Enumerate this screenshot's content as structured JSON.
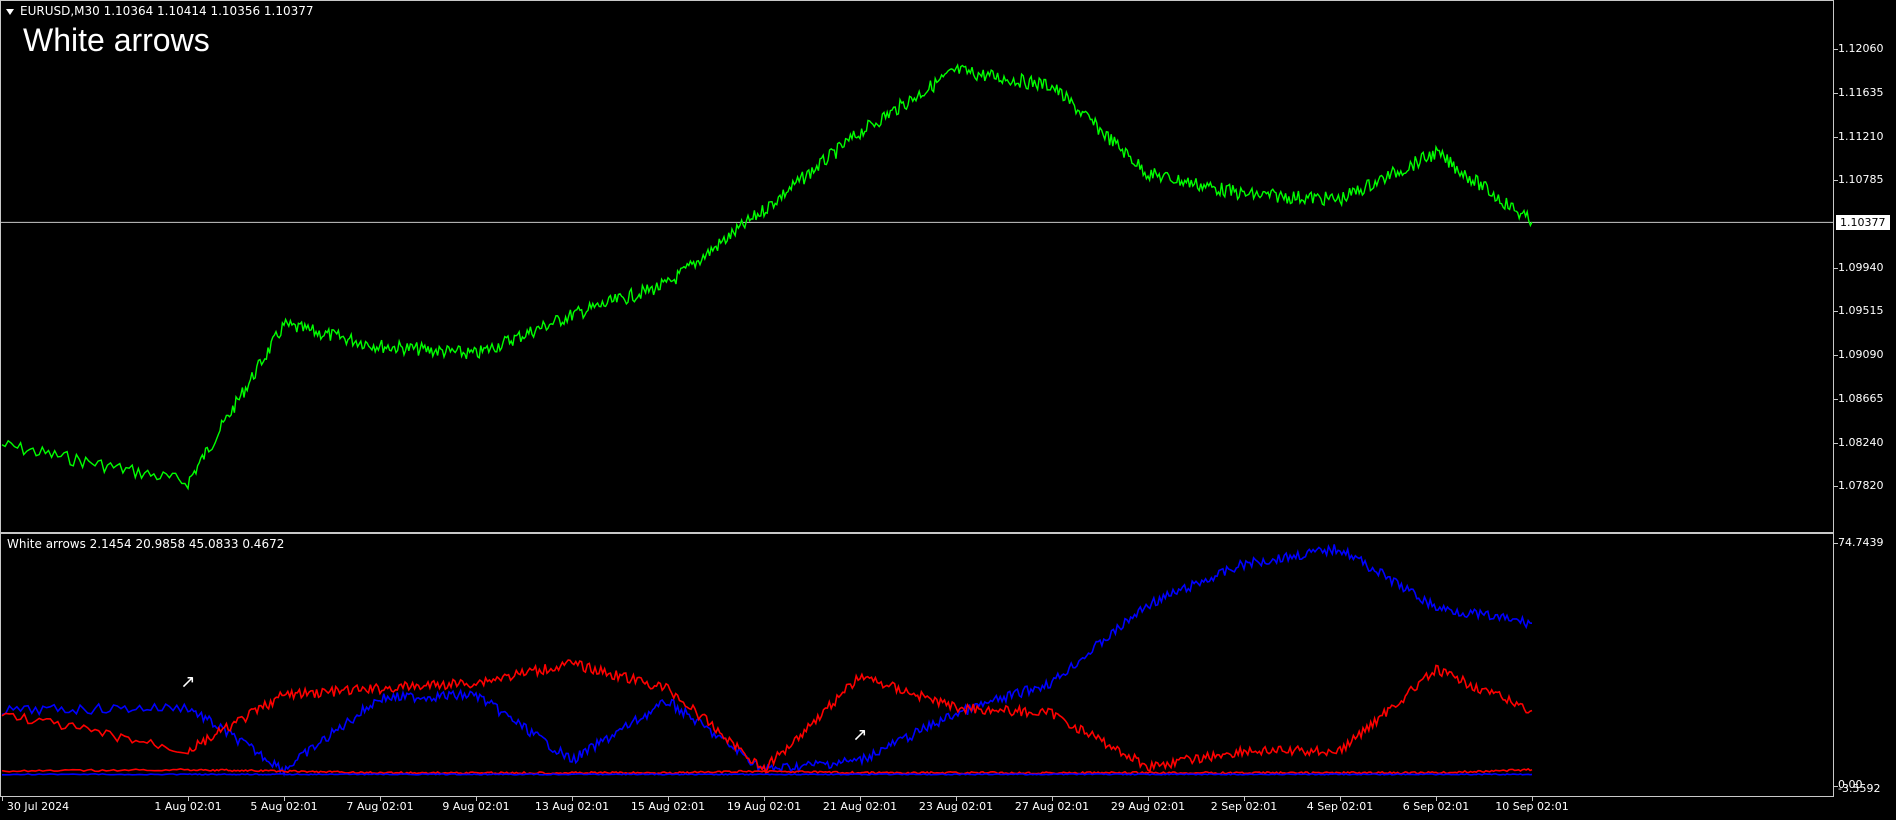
{
  "main_chart": {
    "symbol_menu_icon": "triangle-down-icon",
    "header": "EURUSD,M30  1.10364 1.10414 1.10356 1.10377",
    "indicator_overlay_title": "White arrows",
    "current_price": "1.10377",
    "price_line_color": "#c8c8c8",
    "series_color": "#00ff00",
    "y_ticks": [
      "1.12060",
      "1.11635",
      "1.11210",
      "1.10785",
      "1.09940",
      "1.09515",
      "1.09090",
      "1.08665",
      "1.08240",
      "1.07820"
    ]
  },
  "sub_window": {
    "header": "White arrows 2.1454 20.9858 45.0833 0.4672",
    "y_max_label": "74.7439",
    "y_zero_label": "0.00",
    "y_min_label": "-3.5592",
    "colors": {
      "blue": "#0000ff",
      "red": "#ff0000",
      "arrows": "#ffffff"
    }
  },
  "x_axis": {
    "labels": [
      "30 Jul 2024",
      "1 Aug 02:01",
      "5 Aug 02:01",
      "7 Aug 02:01",
      "9 Aug 02:01",
      "13 Aug 02:01",
      "15 Aug 02:01",
      "19 Aug 02:01",
      "21 Aug 02:01",
      "23 Aug 02:01",
      "27 Aug 02:01",
      "29 Aug 02:01",
      "2 Sep 02:01",
      "4 Sep 02:01",
      "6 Sep 02:01",
      "10 Sep 02:01"
    ]
  },
  "chart_data": [
    {
      "type": "line",
      "title": "",
      "symbol": "EURUSD",
      "timeframe": "M30",
      "ohlc_last": {
        "open": 1.10364,
        "high": 1.10414,
        "low": 1.10356,
        "close": 1.10377
      },
      "ylim": [
        1.0757,
        1.1232
      ],
      "x": [
        "30 Jul 2024",
        "1 Aug 02:01",
        "5 Aug 02:01",
        "7 Aug 02:01",
        "9 Aug 02:01",
        "13 Aug 02:01",
        "15 Aug 02:01",
        "19 Aug 02:01",
        "21 Aug 02:01",
        "23 Aug 02:01",
        "27 Aug 02:01",
        "29 Aug 02:01",
        "2 Sep 02:01",
        "4 Sep 02:01",
        "6 Sep 02:01",
        "10 Sep 02:01"
      ],
      "series": [
        {
          "values": [
            1.0822,
            1.0786,
            1.0938,
            1.0918,
            1.091,
            1.0948,
            1.0978,
            1.105,
            1.1125,
            1.1185,
            1.117,
            1.1085,
            1.1065,
            1.106,
            1.1105,
            1.1038
          ]
        }
      ]
    },
    {
      "type": "line",
      "title": "White arrows",
      "ylim": [
        -3.5592,
        74.7439
      ],
      "x": [
        "30 Jul 2024",
        "1 Aug 02:01",
        "5 Aug 02:01",
        "7 Aug 02:01",
        "9 Aug 02:01",
        "13 Aug 02:01",
        "15 Aug 02:01",
        "19 Aug 02:01",
        "21 Aug 02:01",
        "23 Aug 02:01",
        "27 Aug 02:01",
        "29 Aug 02:01",
        "2 Sep 02:01",
        "4 Sep 02:01",
        "6 Sep 02:01",
        "10 Sep 02:01"
      ],
      "series": [
        {
          "values": [
            21,
            22,
            2,
            25,
            26,
            5,
            24,
            2,
            5,
            20,
            30,
            55,
            68,
            73,
            54,
            49
          ]
        },
        {
          "values": [
            20,
            8,
            26,
            28,
            30,
            36,
            28,
            2,
            32,
            22,
            20,
            3,
            8,
            8,
            34,
            21
          ]
        },
        {
          "values": [
            1.5,
            2,
            1.5,
            1,
            1,
            1,
            1,
            1.5,
            1,
            1,
            1,
            1,
            1,
            1,
            1,
            2
          ]
        },
        {
          "values": [
            0.5,
            0.5,
            0.5,
            0.5,
            0.5,
            0.5,
            0.5,
            0.5,
            0.5,
            0.5,
            0.5,
            0.5,
            0.5,
            0.5,
            0.5,
            0.5
          ]
        }
      ],
      "arrows_at": [
        "1 Aug 02:01",
        "21 Aug 02:01"
      ]
    }
  ]
}
